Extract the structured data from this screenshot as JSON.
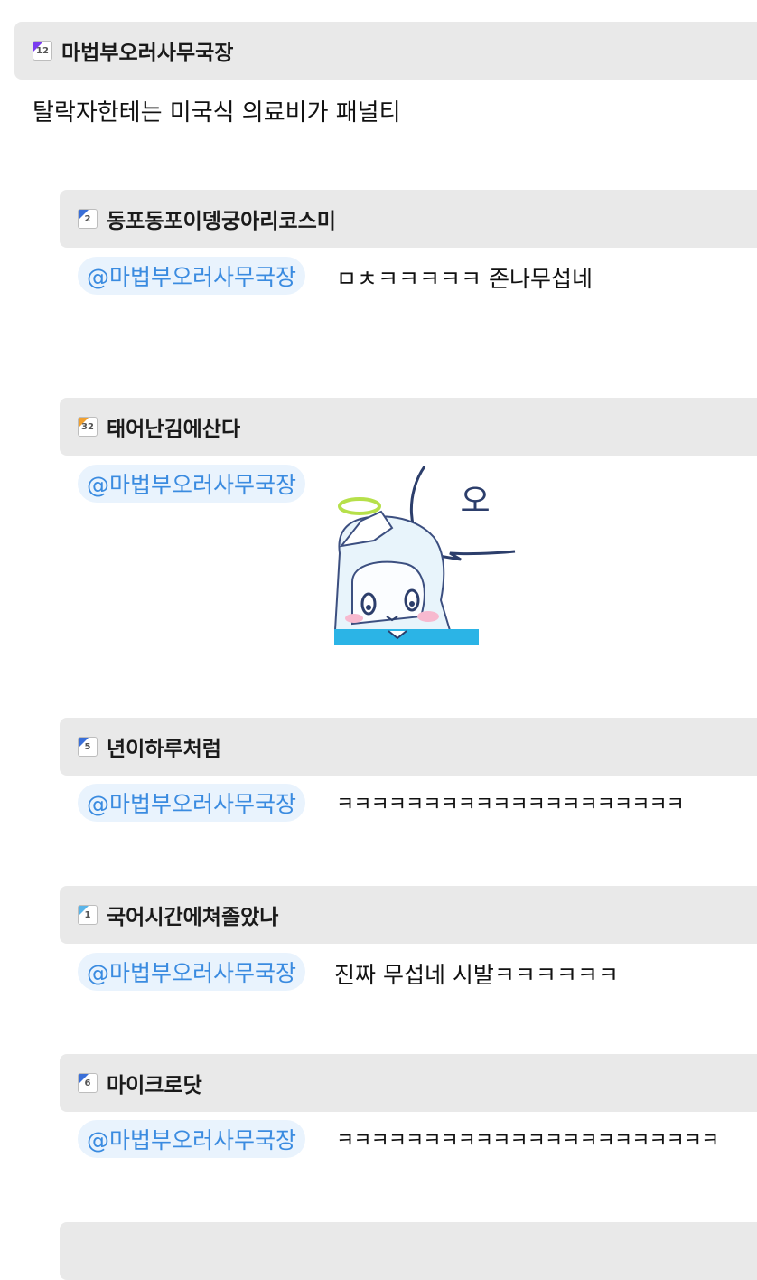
{
  "post": {
    "level": "12",
    "level_color": "#7a3cf0",
    "author": "마법부오러사무국장",
    "text": "탈락자한테는 미국식 의료비가 패널티"
  },
  "replies": [
    {
      "level": "2",
      "level_color": "#3a6fd8",
      "author": "동포동포이뎅궁아리코스미",
      "mention": "@마법부오러사무국장",
      "text": "ㅁㅊㅋㅋㅋㅋㅋ 존나무섭네"
    },
    {
      "level": "32",
      "level_color": "#f0a030",
      "author": "태어난김에산다",
      "mention": "@마법부오러사무국장",
      "sticker_text": "오"
    },
    {
      "level": "5",
      "level_color": "#3a6fd8",
      "author": "년이하루처럼",
      "mention": "@마법부오러사무국장",
      "text": "ㅋㅋㅋㅋㅋㅋㅋㅋㅋㅋㅋㅋㅋㅋㅋㅋㅋㅋㅋㅋ"
    },
    {
      "level": "1",
      "level_color": "#5ab4e8",
      "author": "국어시간에쳐졸았나",
      "mention": "@마법부오러사무국장",
      "text": "진짜 무섭네 시발ㅋㅋㅋㅋㅋㅋ"
    },
    {
      "level": "6",
      "level_color": "#3a6fd8",
      "author": "마이크로닷",
      "mention": "@마법부오러사무국장",
      "text": "ㅋㅋㅋㅋㅋㅋㅋㅋㅋㅋㅋㅋㅋㅋㅋㅋㅋㅋㅋㅋㅋㅋ"
    }
  ],
  "colors": {
    "mention_text": "#3a8be0",
    "mention_bg": "#e9f3fd",
    "bar_bg": "#e9e9e9"
  }
}
